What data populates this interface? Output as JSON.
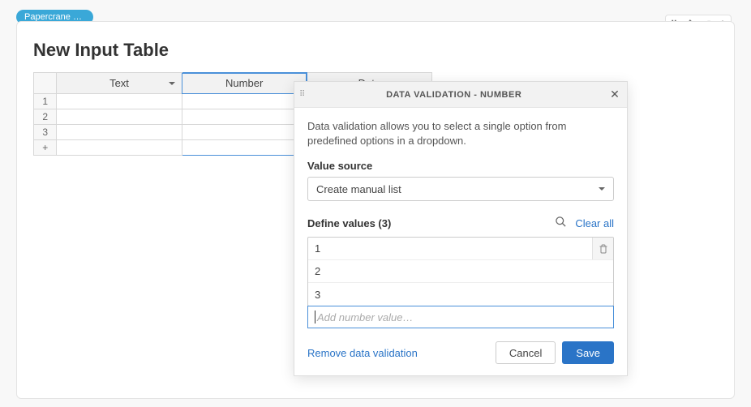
{
  "tab": {
    "label": "Papercrane W…"
  },
  "card": {
    "title": "New Input Table"
  },
  "table": {
    "columns": [
      "Text",
      "Number",
      "Date"
    ],
    "selected_column_index": 1,
    "row_labels": [
      "1",
      "2",
      "3",
      "+"
    ]
  },
  "modal": {
    "title": "DATA VALIDATION - NUMBER",
    "description": "Data validation allows you to select a single option from predefined options in a dropdown.",
    "value_source_label": "Value source",
    "value_source_selected": "Create manual list",
    "define_values_label": "Define values (3)",
    "clear_all": "Clear all",
    "values": [
      "1",
      "2",
      "3"
    ],
    "add_placeholder": "Add number value…",
    "remove_link": "Remove data validation",
    "cancel": "Cancel",
    "save": "Save"
  }
}
